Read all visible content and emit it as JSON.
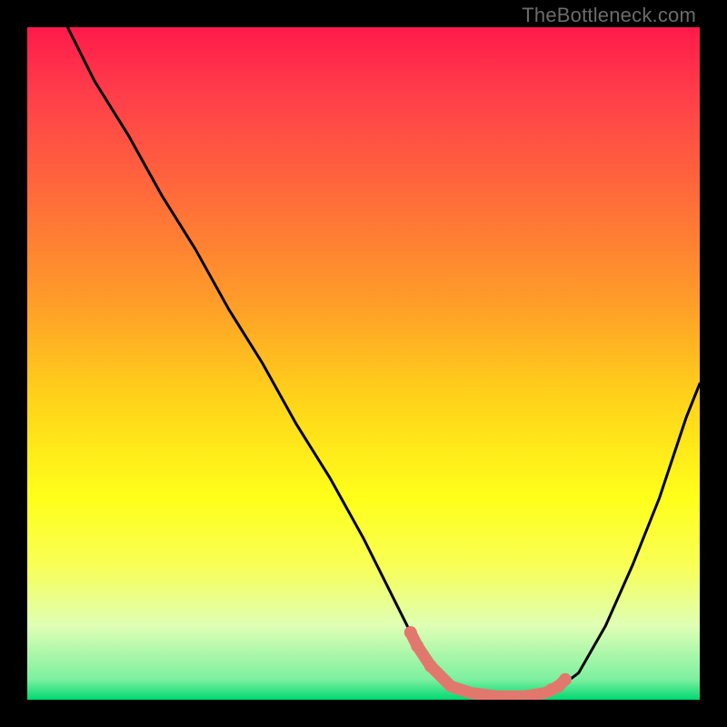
{
  "attribution": "TheBottleneck.com",
  "colors": {
    "page_bg": "#000000",
    "gradient_top": "#ff1a4a",
    "gradient_bottom": "#00d870",
    "curve_stroke": "#000000",
    "marker_fill": "#e2786d"
  },
  "chart_data": {
    "type": "line",
    "title": "",
    "xlabel": "",
    "ylabel": "",
    "xlim": [
      0,
      100
    ],
    "ylim": [
      0,
      100
    ],
    "series": [
      {
        "name": "bottleneck-curve",
        "x": [
          6,
          10,
          15,
          20,
          25,
          30,
          35,
          40,
          45,
          50,
          55,
          57,
          60,
          63,
          66,
          70,
          74,
          78,
          82,
          86,
          90,
          94,
          98,
          100
        ],
        "y": [
          100,
          92,
          84,
          75,
          67,
          58,
          50,
          41,
          33,
          24,
          14,
          10,
          5,
          2,
          1,
          0.5,
          0.5,
          1,
          4,
          11,
          20,
          30,
          42,
          47
        ]
      }
    ],
    "markers": {
      "name": "highlight-segment",
      "x": [
        57,
        58,
        60,
        63,
        66,
        70,
        74,
        77,
        78,
        79,
        80
      ],
      "y": [
        10,
        8,
        5,
        2,
        1,
        0.5,
        0.5,
        1,
        1.5,
        2,
        3
      ]
    }
  }
}
